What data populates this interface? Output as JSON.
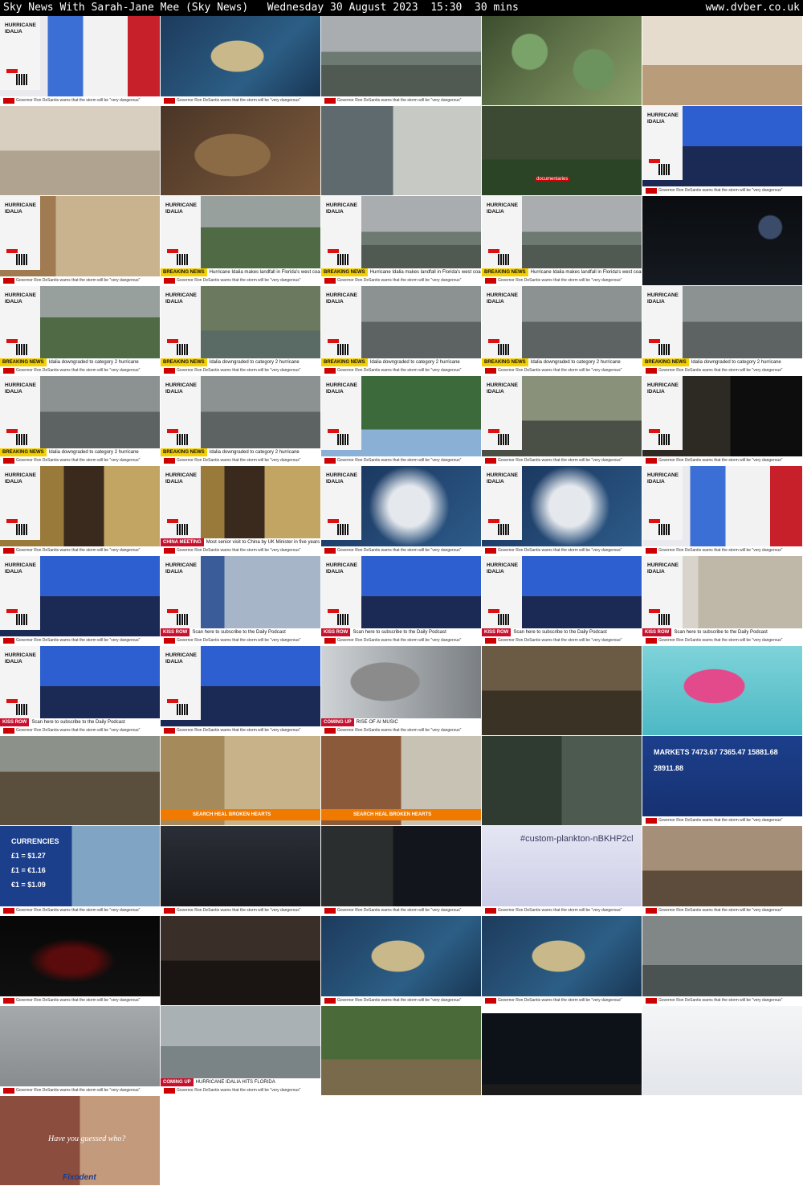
{
  "header": {
    "title": "Sky News With Sarah-Jane Mee (Sky News)   Wednesday 30 August 2023  15:30  30 mins",
    "site": "www.dvber.co.uk"
  },
  "labels": {
    "hurricane": "HURRICANE\nIDALIA",
    "markets": "MARKETS",
    "currencies": "CURRENCIES",
    "hashtag": "#custom-plankton-nBKHP2cl",
    "fixodent": "Fixodent",
    "have_you_guessed": "Have you guessed who?",
    "documentaries": "documentaries"
  },
  "straps": {
    "breaking": "BREAKING NEWS",
    "landfall": "Hurricane Idalia makes landfall in Florida's west coast",
    "downgraded": "Idalia downgraded to category 2 hurricane",
    "china_tag": "CHINA MEETING",
    "china_text": "Most senior visit to China by UK Minister in five years",
    "kiss_tag": "KISS ROW",
    "kiss_text": "Scan here to subscribe to the Daily Podcast",
    "coming_up": "COMING UP",
    "rise_ai": "RISE OF AI MUSIC",
    "idalia_hits": "HURRICANE IDALIA HITS FLORIDA",
    "search_brooke": "SEARCH  HEAL BROKEN HEARTS"
  },
  "ticker": "Governor Ron DeSantis warns that the storm will be \"very dangerous\"",
  "markets_values": [
    "7473.67",
    "7365.47",
    "15881.68",
    "28911.88"
  ],
  "currency_values": [
    "£1 = $1.27",
    "£1 = €1.16",
    "€1 = $1.09"
  ],
  "colors": {
    "sky_red": "#c00",
    "breaking_yellow": "#f5d000",
    "strap_red": "#c8102e",
    "brooke_orange": "#f07a00"
  },
  "thumbnails": [
    {
      "name": "presenter-studio",
      "scene": "studio-presenter",
      "bar": true,
      "ticker": true
    },
    {
      "name": "weather-map-uk",
      "scene": "weather-map",
      "bar": false,
      "ticker": true
    },
    {
      "name": "flooded-coast",
      "scene": "coast",
      "bar": false,
      "ticker": true
    },
    {
      "name": "vax-ad-cells",
      "scene": "cells",
      "bar": false,
      "ticker": false
    },
    {
      "name": "vax-ad-family",
      "scene": "family",
      "bar": false,
      "ticker": false
    },
    {
      "name": "closeup-texture",
      "scene": "beige",
      "bar": false,
      "ticker": false
    },
    {
      "name": "closeup-texture-2",
      "scene": "brown",
      "bar": false,
      "ticker": false
    },
    {
      "name": "doc-couple",
      "scene": "indoor",
      "bar": false,
      "ticker": false
    },
    {
      "name": "doc-football",
      "scene": "field",
      "bar": false,
      "ticker": false,
      "caption": "documentaries"
    },
    {
      "name": "show-studio-wide",
      "scene": "studio-blue",
      "bar": true,
      "ticker": true
    },
    {
      "name": "guest-interview",
      "scene": "guest",
      "bar": true,
      "ticker": true
    },
    {
      "name": "landfall-aerial",
      "scene": "trees",
      "bar": true,
      "ticker": true,
      "strap": "breaking",
      "strap_text": "landfall"
    },
    {
      "name": "landfall-coast",
      "scene": "coast",
      "bar": true,
      "ticker": true,
      "strap": "breaking",
      "strap_text": "landfall"
    },
    {
      "name": "landfall-bay",
      "scene": "coast",
      "bar": true,
      "ticker": true,
      "strap": "breaking",
      "strap_text": "landfall"
    },
    {
      "name": "night-shore",
      "scene": "night",
      "bar": false,
      "ticker": false
    },
    {
      "name": "downgraded-trees",
      "scene": "trees",
      "bar": true,
      "ticker": true,
      "strap": "breaking",
      "strap_text": "downgraded"
    },
    {
      "name": "downgraded-flood",
      "scene": "flood",
      "bar": true,
      "ticker": true,
      "strap": "breaking",
      "strap_text": "downgraded"
    },
    {
      "name": "downgraded-storm",
      "scene": "storm",
      "bar": true,
      "ticker": true,
      "strap": "breaking",
      "strap_text": "downgraded"
    },
    {
      "name": "downgraded-house",
      "scene": "storm",
      "bar": true,
      "ticker": true,
      "strap": "breaking",
      "strap_text": "downgraded"
    },
    {
      "name": "downgraded-wreck",
      "scene": "storm",
      "bar": true,
      "ticker": true,
      "strap": "breaking",
      "strap_text": "downgraded"
    },
    {
      "name": "storm-surf",
      "scene": "storm",
      "bar": true,
      "ticker": true,
      "strap": "breaking",
      "strap_text": "downgraded"
    },
    {
      "name": "storm-palms",
      "scene": "storm",
      "bar": true,
      "ticker": true,
      "strap": "breaking",
      "strap_text": "downgraded"
    },
    {
      "name": "child-photo",
      "scene": "child",
      "bar": true,
      "ticker": true
    },
    {
      "name": "pier-posts",
      "scene": "sea-green",
      "bar": true,
      "ticker": true
    },
    {
      "name": "dark-portrait",
      "scene": "dark",
      "bar": true,
      "ticker": true
    },
    {
      "name": "minister-china",
      "scene": "minister",
      "bar": true,
      "ticker": true
    },
    {
      "name": "minister-china-strap",
      "scene": "minister",
      "bar": true,
      "ticker": true,
      "strap": "red",
      "strap_text": "china"
    },
    {
      "name": "satellite-storm",
      "scene": "satellite",
      "bar": true,
      "ticker": true
    },
    {
      "name": "satellite-storm-2",
      "scene": "satellite",
      "bar": true,
      "ticker": true
    },
    {
      "name": "presenter-closeup",
      "scene": "studio-presenter",
      "bar": true,
      "ticker": true
    },
    {
      "name": "kiss-row-wide",
      "scene": "studio-blue",
      "bar": true,
      "ticker": true
    },
    {
      "name": "kiss-row-guest",
      "scene": "studio-guest",
      "bar": true,
      "ticker": true,
      "strap": "red",
      "strap_text": "kiss"
    },
    {
      "name": "kiss-row-wide-2",
      "scene": "studio-blue",
      "bar": true,
      "ticker": true,
      "strap": "red",
      "strap_text": "kiss"
    },
    {
      "name": "kiss-row-wide-3",
      "scene": "studio-blue",
      "bar": true,
      "ticker": true,
      "strap": "red",
      "strap_text": "kiss"
    },
    {
      "name": "kiss-row-remote",
      "scene": "remote",
      "bar": true,
      "ticker": true,
      "strap": "red",
      "strap_text": "kiss"
    },
    {
      "name": "kiss-row-wide-4",
      "scene": "studio-blue",
      "bar": true,
      "ticker": true,
      "strap": "red",
      "strap_text": "kiss"
    },
    {
      "name": "studio-duo",
      "scene": "studio-blue",
      "bar": true,
      "ticker": true
    },
    {
      "name": "ai-music-sinatra",
      "scene": "sinatra",
      "bar": false,
      "ticker": true,
      "strap": "red",
      "strap_text": "ai"
    },
    {
      "name": "doc-stairs",
      "scene": "stairs",
      "bar": false,
      "ticker": false
    },
    {
      "name": "vanish-ad",
      "scene": "vanish",
      "bar": false,
      "ticker": false
    },
    {
      "name": "horse-cart",
      "scene": "street",
      "bar": false,
      "ticker": false
    },
    {
      "name": "brooke-horse",
      "scene": "horse",
      "bar": false,
      "ticker": false,
      "orange": true
    },
    {
      "name": "brooke-people",
      "scene": "people",
      "bar": false,
      "ticker": false,
      "orange": true
    },
    {
      "name": "doc-man",
      "scene": "man",
      "bar": false,
      "ticker": false
    },
    {
      "name": "markets-board",
      "scene": "markets",
      "bar": false,
      "ticker": true
    },
    {
      "name": "currencies-board",
      "scene": "currencies",
      "bar": false,
      "ticker": true
    },
    {
      "name": "ai-laptop",
      "scene": "laptop",
      "bar": false,
      "ticker": true
    },
    {
      "name": "ai-code",
      "scene": "code",
      "bar": false,
      "ticker": true
    },
    {
      "name": "ai-plankton",
      "scene": "plankton",
      "bar": false,
      "ticker": true
    },
    {
      "name": "ai-records",
      "scene": "records",
      "bar": false,
      "ticker": true
    },
    {
      "name": "ai-singer",
      "scene": "singer",
      "bar": false,
      "ticker": true
    },
    {
      "name": "qatar-ad",
      "scene": "cabin",
      "bar": false,
      "ticker": false
    },
    {
      "name": "weather-map-2",
      "scene": "weather-map",
      "bar": false,
      "ticker": true
    },
    {
      "name": "weather-map-3",
      "scene": "weather-map",
      "bar": false,
      "ticker": true
    },
    {
      "name": "city-skyline",
      "scene": "skyline",
      "bar": false,
      "ticker": true
    },
    {
      "name": "grey-sky",
      "scene": "greysky",
      "bar": false,
      "ticker": true
    },
    {
      "name": "bridge-idalia",
      "scene": "bridge",
      "bar": false,
      "ticker": true,
      "strap": "red",
      "strap_text": "idalia"
    },
    {
      "name": "runners-ad",
      "scene": "runners",
      "bar": false,
      "ticker": false
    },
    {
      "name": "dark-ad",
      "scene": "darkad",
      "bar": false,
      "ticker": false
    },
    {
      "name": "webpage",
      "scene": "webpage",
      "bar": false,
      "ticker": false
    },
    {
      "name": "fixodent-ad",
      "scene": "fixodent",
      "bar": false,
      "ticker": false
    }
  ]
}
